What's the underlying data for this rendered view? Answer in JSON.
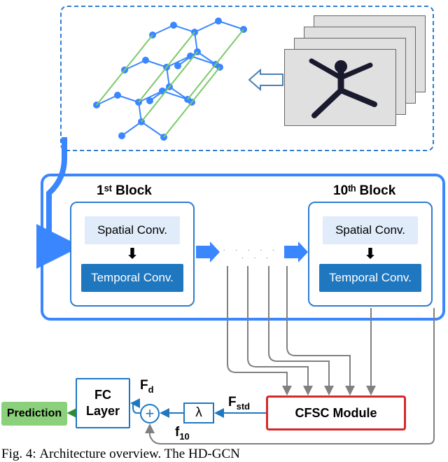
{
  "caption_prefix": "Fig. 4:",
  "caption_text": "Architecture overview. The HD-GCN",
  "top": {
    "arrow_dir": "right-to-left"
  },
  "blocks": {
    "first": {
      "title": "1ˢᵗ Block",
      "spatial": "Spatial Conv.",
      "temporal": "Temporal Conv."
    },
    "last": {
      "title": "10ᵗʰ Block",
      "spatial": "Spatial Conv.",
      "temporal": "Temporal Conv."
    },
    "dots": ". . . . . . . . ."
  },
  "cfsc": "CFSC Module",
  "lambda": "λ",
  "plus": "+",
  "fc": "FC Layer",
  "prediction": "Prediction",
  "labels": {
    "Fstd": "F",
    "Fstd_sub": "std",
    "Fd": "F",
    "Fd_sub": "d",
    "f10": "f",
    "f10_sub": "10"
  },
  "chart_data": {
    "type": "diagram",
    "description": "Neural network architecture overview",
    "flow": [
      "video_frames -> spatiotemporal_skeleton_graph",
      "graph -> block_1 (SpatialConv -> TemporalConv)",
      "block_1 -> ... -> block_10",
      "intermediate_blocks [6..10] -> CFSC_Module",
      "CFSC_Module -> F_std -> scale(lambda) -> sum(+) with f_10 -> F_d -> FC_Layer -> Prediction",
      "block_10 -> f_10 -> sum(+)"
    ],
    "num_blocks": 10,
    "block_internal_order": [
      "Spatial Conv.",
      "Temporal Conv."
    ],
    "cfsc_inputs_from_last_n_blocks": 5,
    "fusion": "F_d = f_10 + lambda * F_std"
  }
}
